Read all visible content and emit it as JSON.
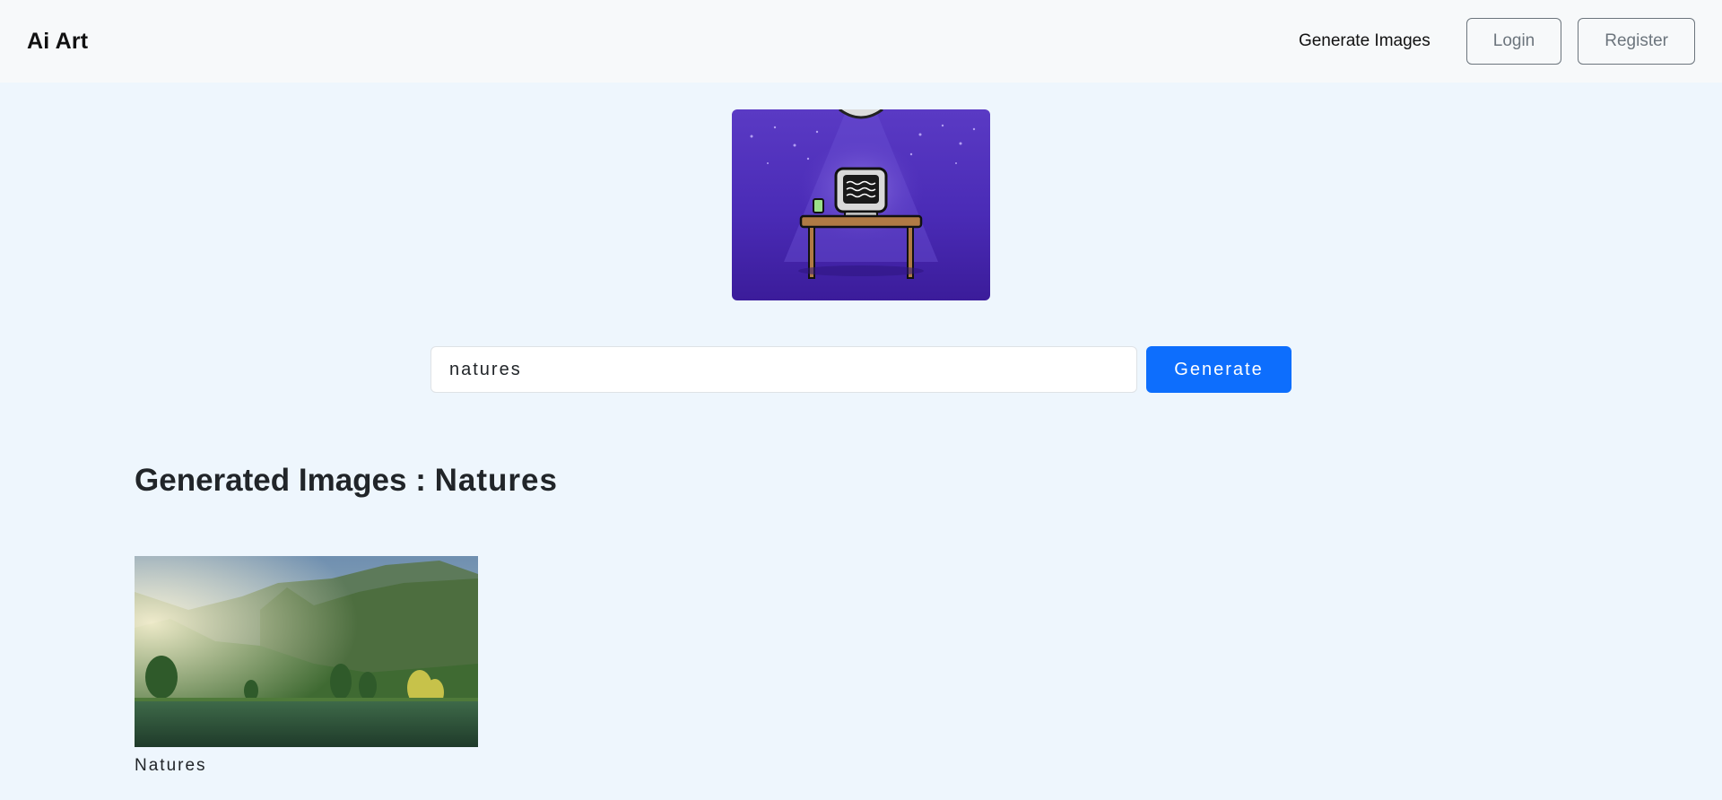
{
  "navbar": {
    "brand": "Ai Art",
    "links": {
      "generate_images": "Generate Images"
    },
    "buttons": {
      "login": "Login",
      "register": "Register"
    }
  },
  "hero": {
    "image": "computer-on-desk-illustration"
  },
  "search": {
    "value": "natures",
    "button_label": "Generate"
  },
  "results": {
    "heading_prefix": "Generated Images : ",
    "heading_query": "Natures",
    "items": [
      {
        "caption": "Natures",
        "image": "mountain-lake-landscape"
      }
    ]
  },
  "colors": {
    "background": "#eef6fd",
    "navbar": "#f7f9fa",
    "primary": "#0d6efd",
    "hero_purple": "#4a2bb6"
  }
}
